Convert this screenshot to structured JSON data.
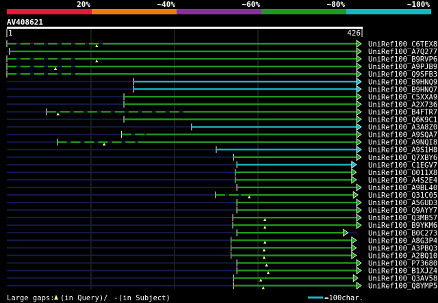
{
  "chart_data": {
    "type": "alignment-coverage",
    "query_name": "AV408621",
    "query_length": 426,
    "axis": {
      "start_label": "1",
      "end_label": "426",
      "min": 1,
      "max": 426
    },
    "identity_legend": [
      {
        "label": "20%",
        "color": "#e8183a"
      },
      {
        "label": "~40%",
        "color": "#ea7b14"
      },
      {
        "label": "~60%",
        "color": "#8c2ea0"
      },
      {
        "label": "~80%",
        "color": "#1f9a1f"
      },
      {
        "label": "~100%",
        "color": "#17b7c4"
      }
    ],
    "hits": [
      {
        "name": "UniRef100_C6TEX8",
        "color": "#1f9a1f",
        "start": 1,
        "end": 426,
        "dashed_to": 120,
        "gaps": [
          110
        ]
      },
      {
        "name": "UniRef100_A7Q277",
        "color": "#1f9a1f",
        "start": 4,
        "end": 426,
        "dashed_to": null,
        "gaps": []
      },
      {
        "name": "UniRef100_B9RVP6",
        "color": "#1f9a1f",
        "start": 1,
        "end": 426,
        "dashed_to": 95,
        "gaps": [
          110
        ]
      },
      {
        "name": "UniRef100_A9PJB9",
        "color": "#1f9a1f",
        "start": 1,
        "end": 426,
        "dashed_to": 95,
        "gaps": [
          60
        ]
      },
      {
        "name": "UniRef100_Q9SFB3",
        "color": "#1f9a1f",
        "start": 1,
        "end": 426,
        "dashed_to": 95,
        "gaps": []
      },
      {
        "name": "UniRef100_B9HNQ9",
        "color": "#17b7c4",
        "start": 155,
        "end": 426,
        "dashed_to": null,
        "gaps": []
      },
      {
        "name": "UniRef100_B9HNQ7",
        "color": "#17b7c4",
        "start": 155,
        "end": 426,
        "dashed_to": null,
        "gaps": []
      },
      {
        "name": "UniRef100_C5XXA9",
        "color": "#1f9a1f",
        "start": 143,
        "end": 426,
        "dashed_to": null,
        "gaps": []
      },
      {
        "name": "UniRef100_A2X736",
        "color": "#1f9a1f",
        "start": 143,
        "end": 426,
        "dashed_to": null,
        "gaps": []
      },
      {
        "name": "UniRef100_B4FTR7",
        "color": "#1f9a1f",
        "start": 49,
        "end": 426,
        "dashed_to": 225,
        "gaps": [
          63
        ]
      },
      {
        "name": "UniRef100_Q6K9C1",
        "color": "#1f9a1f",
        "start": 143,
        "end": 426,
        "dashed_to": null,
        "gaps": []
      },
      {
        "name": "UniRef100_A3A8Z0",
        "color": "#17b7c4",
        "start": 225,
        "end": 426,
        "dashed_to": null,
        "gaps": []
      },
      {
        "name": "UniRef100_A9SQA7",
        "color": "#1f9a1f",
        "start": 140,
        "end": 426,
        "dashed_to": 170,
        "gaps": []
      },
      {
        "name": "UniRef100_A9NQI8",
        "color": "#1f9a1f",
        "start": 62,
        "end": 426,
        "dashed_to": 160,
        "gaps": [
          119
        ]
      },
      {
        "name": "UniRef100_A9S1H8",
        "color": "#17b7c4",
        "start": 255,
        "end": 426,
        "dashed_to": null,
        "gaps": []
      },
      {
        "name": "UniRef100_Q7XBY6",
        "color": "#1f9a1f",
        "start": 276,
        "end": 426,
        "dashed_to": null,
        "gaps": []
      },
      {
        "name": "UniRef100_C1EGV7",
        "color": "#17b7c4",
        "start": 280,
        "end": 420,
        "dashed_to": null,
        "gaps": []
      },
      {
        "name": "UniRef100_O011X8",
        "color": "#1f9a1f",
        "start": 278,
        "end": 420,
        "dashed_to": null,
        "gaps": []
      },
      {
        "name": "UniRef100_A4S2E4",
        "color": "#1f9a1f",
        "start": 278,
        "end": 420,
        "dashed_to": null,
        "gaps": []
      },
      {
        "name": "UniRef100_A9BL40",
        "color": "#1f9a1f",
        "start": 280,
        "end": 426,
        "dashed_to": null,
        "gaps": []
      },
      {
        "name": "UniRef100_Q31C05",
        "color": "#1f9a1f",
        "start": 254,
        "end": 422,
        "dashed_to": 285,
        "gaps": [
          295
        ]
      },
      {
        "name": "UniRef100_A5GUD3",
        "color": "#1f9a1f",
        "start": 280,
        "end": 426,
        "dashed_to": null,
        "gaps": []
      },
      {
        "name": "UniRef100_Q9AYY7",
        "color": "#1f9a1f",
        "start": 280,
        "end": 426,
        "dashed_to": null,
        "gaps": []
      },
      {
        "name": "UniRef100_Q3MB57",
        "color": "#1f9a1f",
        "start": 275,
        "end": 426,
        "dashed_to": null,
        "gaps": [
          314
        ]
      },
      {
        "name": "UniRef100_B9YKM6",
        "color": "#1f9a1f",
        "start": 275,
        "end": 426,
        "dashed_to": null,
        "gaps": [
          314
        ]
      },
      {
        "name": "UniRef100_B0C273",
        "color": "#1f9a1f",
        "start": 280,
        "end": 410,
        "dashed_to": null,
        "gaps": []
      },
      {
        "name": "UniRef100_A8G3P4",
        "color": "#1f9a1f",
        "start": 273,
        "end": 420,
        "dashed_to": null,
        "gaps": [
          314
        ]
      },
      {
        "name": "UniRef100_A3PBQ3",
        "color": "#1f9a1f",
        "start": 273,
        "end": 420,
        "dashed_to": null,
        "gaps": [
          313
        ]
      },
      {
        "name": "UniRef100_A2BQ10",
        "color": "#1f9a1f",
        "start": 273,
        "end": 420,
        "dashed_to": null,
        "gaps": [
          313
        ]
      },
      {
        "name": "UniRef100_P73680",
        "color": "#1f9a1f",
        "start": 280,
        "end": 426,
        "dashed_to": null,
        "gaps": [
          316
        ]
      },
      {
        "name": "UniRef100_B1XJZ4",
        "color": "#1f9a1f",
        "start": 280,
        "end": 426,
        "dashed_to": null,
        "gaps": [
          318
        ]
      },
      {
        "name": "UniRef100_Q3AV58",
        "color": "#1f9a1f",
        "start": 276,
        "end": 422,
        "dashed_to": null,
        "gaps": [
          309
        ]
      },
      {
        "name": "UniRef100_Q8YMP5",
        "color": "#1f9a1f",
        "start": 276,
        "end": 426,
        "dashed_to": null,
        "gaps": [
          312
        ]
      }
    ],
    "footer": {
      "gaps_label": "Large gaps: ",
      "in_query": "(in Query)/",
      "dash_glyph": "-",
      "in_subject": " (in Subject)",
      "scale_label": "=100char."
    }
  }
}
